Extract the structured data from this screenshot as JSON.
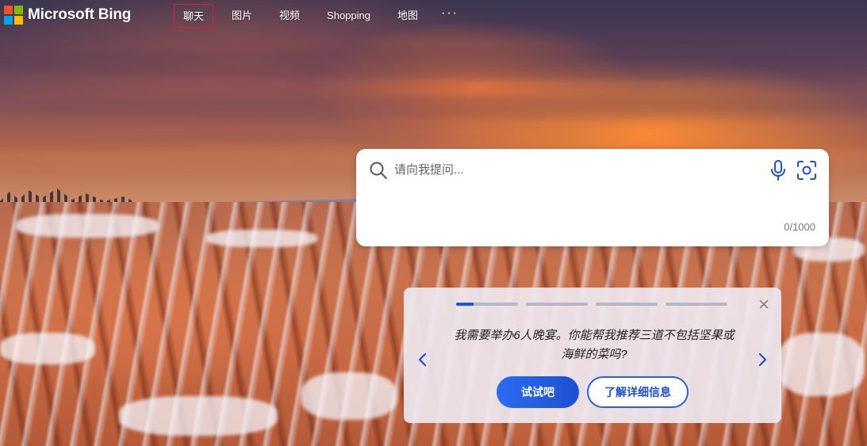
{
  "header": {
    "brand": "Microsoft Bing",
    "logo_colors": [
      "#f25022",
      "#7fba00",
      "#00a4ef",
      "#ffb900"
    ],
    "nav": [
      {
        "label": "聊天",
        "active": true
      },
      {
        "label": "图片",
        "active": false
      },
      {
        "label": "视频",
        "active": false
      },
      {
        "label": "Shopping",
        "active": false
      },
      {
        "label": "地图",
        "active": false
      }
    ],
    "more_label": "···"
  },
  "search": {
    "placeholder": "请向我提问...",
    "value": "",
    "char_count": "0/1000",
    "icons": [
      "search-icon",
      "microphone-icon",
      "visual-search-icon"
    ]
  },
  "suggestion_card": {
    "prompt": "我需要举办6人晚宴。你能帮我推荐三道不包括坚果或海鲜的菜吗?",
    "progress_total": 4,
    "progress_current": 1,
    "progress_fraction_first": 0.28,
    "try_label": "试试吧",
    "learn_label": "了解详细信息",
    "accent_color": "#1d4fd1"
  }
}
